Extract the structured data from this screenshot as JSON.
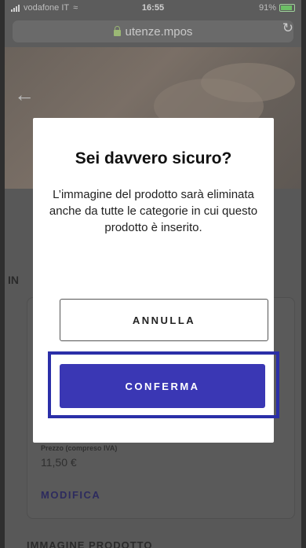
{
  "status_bar": {
    "carrier": "vodafone IT",
    "time": "16:55",
    "battery": "91%"
  },
  "browser": {
    "url": "utenze.mpos"
  },
  "page": {
    "section_partial": "IN",
    "price_label": "Prezzo (compreso IVA)",
    "price_value": "11,50 €",
    "modify_link": "MODIFICA",
    "image_section": "IMMAGINE PRODOTTO"
  },
  "modal": {
    "title": "Sei davvero sicuro?",
    "message": "L’immagine del prodotto sarà eliminata anche da tutte le categorie in cui questo prodotto è inserito.",
    "cancel_label": "ANNULLA",
    "confirm_label": "CONFERMA"
  },
  "colors": {
    "accent": "#3a37b4",
    "highlight": "#2b2fa8",
    "overlay": "#585858"
  }
}
